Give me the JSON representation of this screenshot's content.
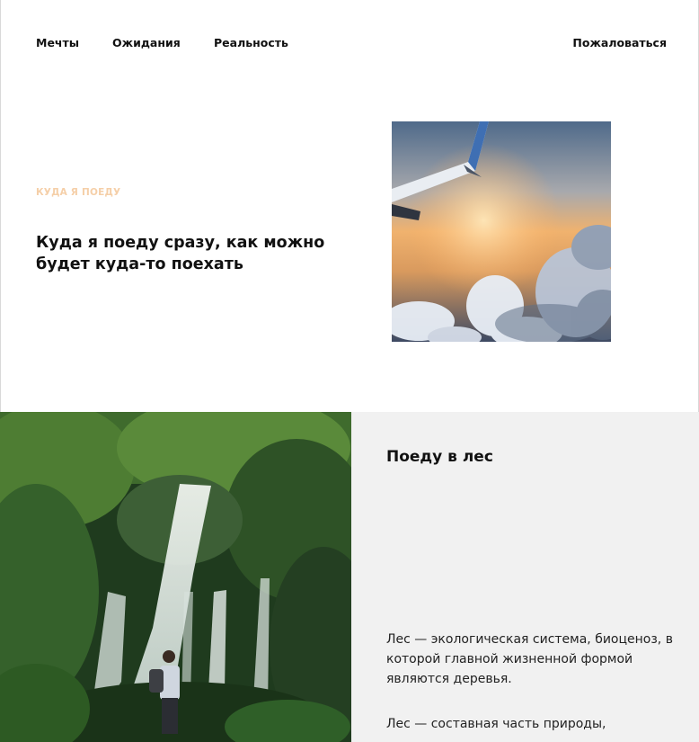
{
  "nav": {
    "items": [
      "Мечты",
      "Ожидания",
      "Реальность"
    ],
    "complain": "Пожаловаться"
  },
  "hero": {
    "eyebrow": "КУДА Я ПОЕДУ",
    "title": "Куда я поеду сразу, как можно будет куда-то поехать"
  },
  "forest": {
    "title": "Поеду в лес",
    "paragraphs": [
      "Лес — экологическая система, биоценоз, в которой главной жизненной формой являются деревья.",
      "Лес — составная часть природы,"
    ]
  },
  "colors": {
    "eyebrow": "#f5cfa8",
    "panel_bg": "#f1f1f1",
    "text": "#111111"
  },
  "images": {
    "hero": "airplane-wing-above-clouds-sunset",
    "forest": "hiker-at-jungle-waterfall"
  }
}
